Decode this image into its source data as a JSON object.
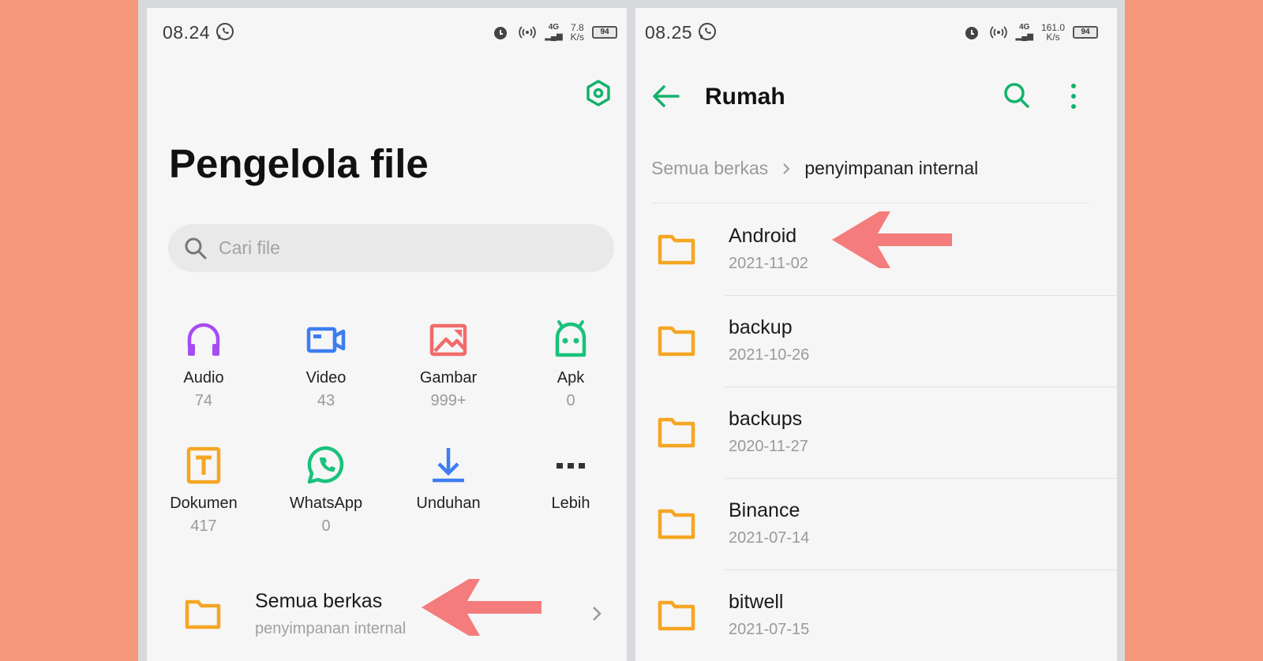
{
  "colors": {
    "background": "#f4977a",
    "accent_green": "#13b26b",
    "folder_orange": "#f5a623",
    "arrow_red": "#f47c7c"
  },
  "left_screen": {
    "status_bar": {
      "time": "08.24",
      "net_speed_value": "7.8",
      "net_speed_unit": "K/s",
      "battery": "94",
      "network": "4G"
    },
    "title": "Pengelola file",
    "search": {
      "placeholder": "Cari file"
    },
    "categories": [
      {
        "label": "Audio",
        "count": "74",
        "icon": "headphones-icon",
        "color": "#a64bf4"
      },
      {
        "label": "Video",
        "count": "43",
        "icon": "video-camera-icon",
        "color": "#3d7df2"
      },
      {
        "label": "Gambar",
        "count": "999+",
        "icon": "image-icon",
        "color": "#f26b6b"
      },
      {
        "label": "Apk",
        "count": "0",
        "icon": "android-icon",
        "color": "#19c27a"
      },
      {
        "label": "Dokumen",
        "count": "417",
        "icon": "document-icon",
        "color": "#f5a623"
      },
      {
        "label": "WhatsApp",
        "count": "0",
        "icon": "whatsapp-icon",
        "color": "#19c27a"
      },
      {
        "label": "Unduhan",
        "count": "",
        "icon": "download-icon",
        "color": "#3d7df2"
      },
      {
        "label": "Lebih",
        "count": "",
        "icon": "more-dots-icon",
        "color": "#333333"
      }
    ],
    "all_files": {
      "title": "Semua berkas",
      "subtitle": "penyimpanan internal"
    }
  },
  "right_screen": {
    "status_bar": {
      "time": "08.25",
      "net_speed_value": "161.0",
      "net_speed_unit": "K/s",
      "battery": "94",
      "network": "4G"
    },
    "title": "Rumah",
    "breadcrumb": [
      "Semua berkas",
      "penyimpanan internal"
    ],
    "folders": [
      {
        "name": "Android",
        "date": "2021-11-02"
      },
      {
        "name": "backup",
        "date": "2021-10-26"
      },
      {
        "name": "backups",
        "date": "2020-11-27"
      },
      {
        "name": "Binance",
        "date": "2021-07-14"
      },
      {
        "name": "bitwell",
        "date": "2021-07-15"
      }
    ]
  }
}
